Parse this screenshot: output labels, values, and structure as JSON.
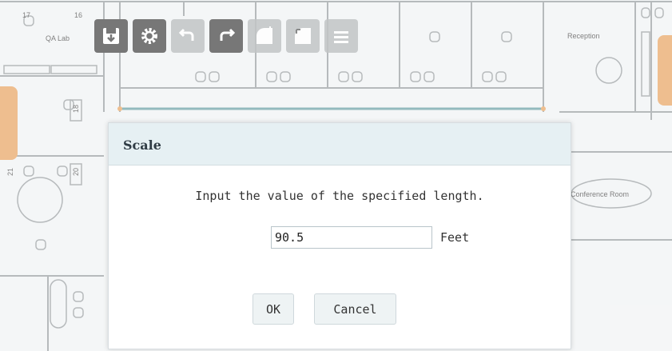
{
  "floor_plan": {
    "labels": {
      "room_17": "17",
      "room_16": "16",
      "qa_lab": "QA Lab",
      "reception": "Reception",
      "conference_room": "Conference Room",
      "desk_18": "18",
      "desk_20": "20",
      "desk_21": "21"
    }
  },
  "toolbar": {
    "tools": [
      {
        "icon": "save-icon",
        "state": "active"
      },
      {
        "icon": "settings-gear-icon",
        "state": "active"
      },
      {
        "icon": "undo-icon",
        "state": "faded"
      },
      {
        "icon": "redo-icon",
        "state": "active"
      },
      {
        "icon": "add-area-icon",
        "state": "faded"
      },
      {
        "icon": "resize-area-icon",
        "state": "faded"
      },
      {
        "icon": "list-icon",
        "state": "faded"
      }
    ]
  },
  "dialog": {
    "title": "Scale",
    "message": "Input the value of the specified length.",
    "length_value": "90.5",
    "unit": "Feet",
    "ok_label": "OK",
    "cancel_label": "Cancel"
  },
  "colors": {
    "accent_handle": "#e9a96a",
    "scale_line": "#6fa3a9",
    "dialog_header": "#e6f0f3"
  }
}
